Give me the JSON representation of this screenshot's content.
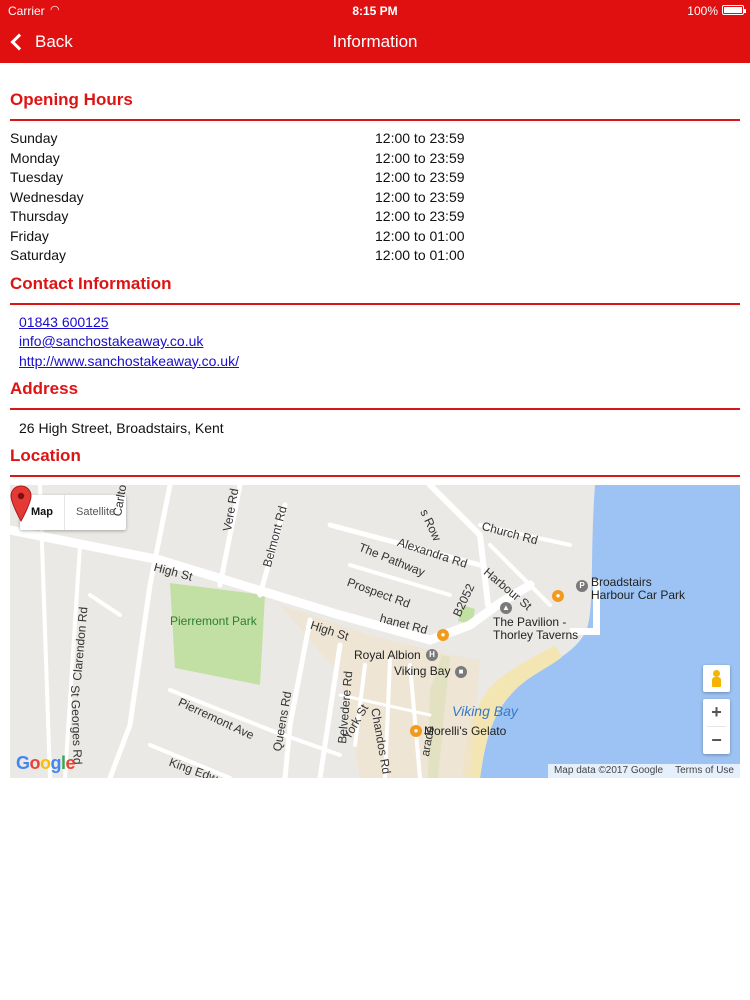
{
  "status_bar": {
    "carrier": "Carrier",
    "time": "8:15 PM",
    "battery": "100%"
  },
  "nav": {
    "back_label": "Back",
    "title": "Information"
  },
  "sections": {
    "opening_hours": "Opening Hours",
    "contact": "Contact Information",
    "address": "Address",
    "location": "Location"
  },
  "hours": [
    {
      "day": "Sunday",
      "time": "12:00 to 23:59"
    },
    {
      "day": "Monday",
      "time": "12:00 to 23:59"
    },
    {
      "day": "Tuesday",
      "time": "12:00 to 23:59"
    },
    {
      "day": "Wednesday",
      "time": "12:00 to 23:59"
    },
    {
      "day": "Thursday",
      "time": "12:00 to 23:59"
    },
    {
      "day": "Friday",
      "time": "12:00 to 01:00"
    },
    {
      "day": "Saturday",
      "time": "12:00 to 01:00"
    }
  ],
  "contact": {
    "phone": "01843 600125",
    "email": "info@sanchostakeaway.co.uk",
    "website": "http://www.sanchostakeaway.co.uk/"
  },
  "address": "26 High Street, Broadstairs, Kent",
  "map": {
    "tab_map": "Map",
    "tab_satellite": "Satellite",
    "zoom_in": "+",
    "zoom_out": "−",
    "attribution": "Map data ©2017 Google",
    "terms": "Terms of Use",
    "logo": {
      "g1": "G",
      "o1": "o",
      "o2": "o",
      "g2": "g",
      "l": "l",
      "e": "e"
    },
    "labels": {
      "carlton_ave": "Carlton Ave",
      "vere_rd": "Vere Rd",
      "belmont_rd": "Belmont Rd",
      "alexandra_rd": "Alexandra Rd",
      "the_pathway": "The Pathway",
      "church_rd": "Church Rd",
      "harbour_st": "Harbour St",
      "high_st_1": "High St",
      "high_st_2": "High St",
      "prospect_rd": "Prospect Rd",
      "thanet_rd": "hanet Rd",
      "b2052": "B2052",
      "clarendon_rd": "Clarendon Rd",
      "pierremont_park": "Pierremont Park",
      "royal_albion": "Royal Albion",
      "viking_bay_poi": "Viking Bay",
      "the_pavilion": "The Pavilion -\nThorley Taverns",
      "broadstairs_car_park": "Broadstairs\nHarbour Car Park",
      "viking_bay_water": "Viking Bay",
      "st_georges_rd": "St Georges Rd",
      "belvedere_rd": "Belvedere Rd",
      "queens_rd": "Queens Rd",
      "pierremont_ave": "Pierremont Ave",
      "york_st": "York St",
      "chandos_rd": "Chandos Rd",
      "morellis": "Morelli's Gelato",
      "parade": "arade",
      "king_edward": "King Edw",
      "row": "s Row"
    }
  }
}
